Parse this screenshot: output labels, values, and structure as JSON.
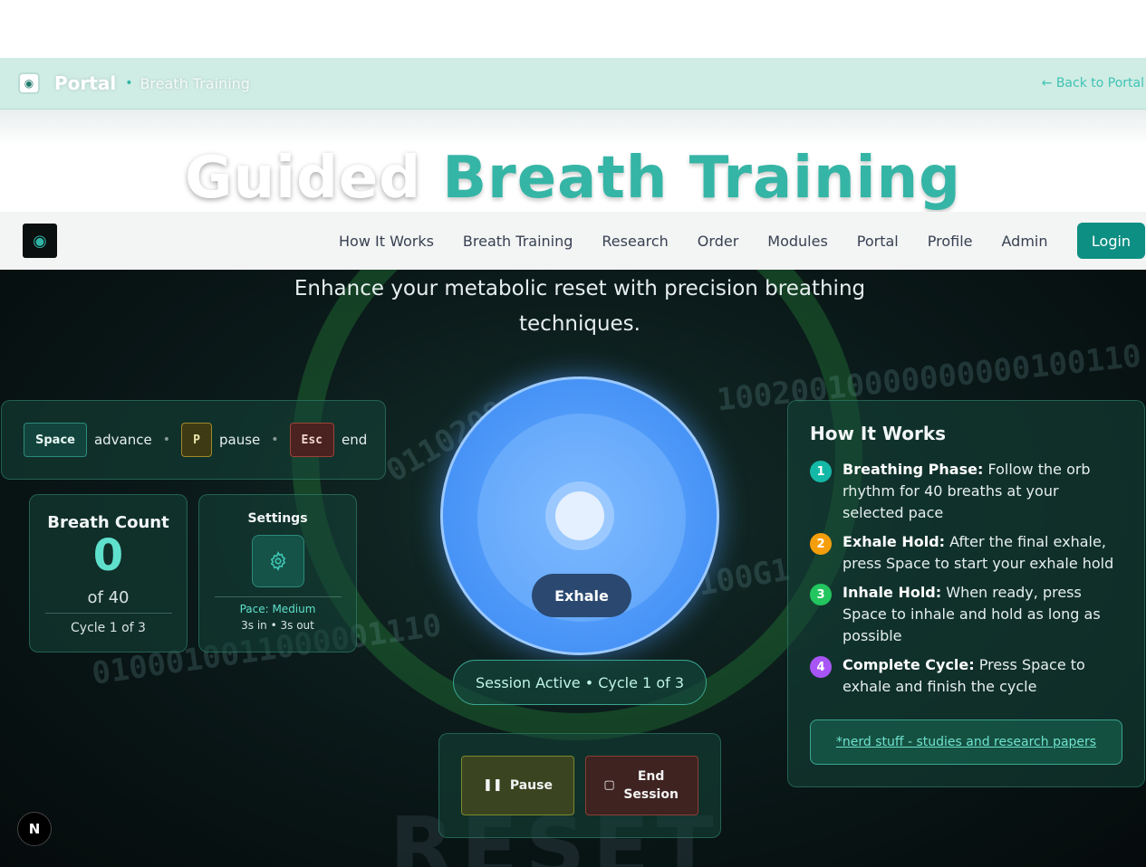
{
  "portal_bar": {
    "title": "Portal",
    "separator": "•",
    "subtitle": "Breath Training",
    "back_link": "← Back to Portal"
  },
  "hero": {
    "title_part1": "Guided",
    "title_part2": "Breath Training"
  },
  "navbar": {
    "links": [
      "How It Works",
      "Breath Training",
      "Research",
      "Order",
      "Modules",
      "Portal",
      "Profile",
      "Admin"
    ],
    "login": "Login"
  },
  "tagline": "Enhance your metabolic reset with precision breathing techniques.",
  "shortcuts": {
    "space_key": "Space",
    "space_text": "advance",
    "p_key": "P",
    "p_text": "pause",
    "esc_key": "Esc",
    "esc_text": "end",
    "separator": "•"
  },
  "breath_count": {
    "title": "Breath Count",
    "value": "0",
    "of": "of 40",
    "cycle": "Cycle 1 of 3"
  },
  "settings": {
    "title": "Settings",
    "pace": "Pace: Medium",
    "timing": "3s in • 3s out"
  },
  "orb": {
    "phase": "Exhale"
  },
  "session": {
    "status": "Session Active • Cycle 1 of 3"
  },
  "controls": {
    "pause": "Pause",
    "end": "End Session"
  },
  "how_it_works": {
    "title": "How It Works",
    "steps": [
      {
        "num": "1",
        "bold": "Breathing Phase:",
        "text": " Follow the orb rhythm for 40 breaths at your selected pace",
        "color": "#14b8a6"
      },
      {
        "num": "2",
        "bold": "Exhale Hold:",
        "text": " After the final exhale, press Space to start your exhale hold",
        "color": "#f59e0b"
      },
      {
        "num": "3",
        "bold": "Inhale Hold:",
        "text": " When ready, press Space to inhale and hold as long as possible",
        "color": "#22c55e"
      },
      {
        "num": "4",
        "bold": "Complete Cycle:",
        "text": " Press Space to exhale and finish the cycle",
        "color": "#a855f7"
      }
    ],
    "nerd_link": "*nerd stuff - studies and research papers"
  },
  "badge": "N",
  "colors": {
    "accent": "#35b5a6",
    "login_bg": "#0e8f83",
    "orb": "#4b97f8"
  }
}
